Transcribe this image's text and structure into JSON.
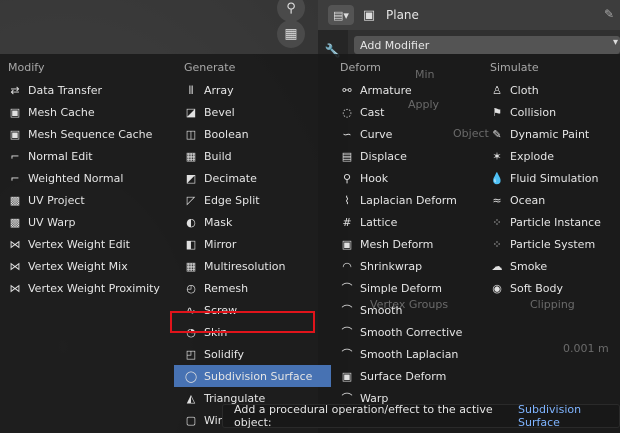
{
  "header": {
    "object_name": "Plane",
    "add_modifier_label": "Add Modifier"
  },
  "ghost": {
    "min": "Min",
    "apply": "Apply",
    "object": "Object",
    "vertex_groups": "Vertex Groups",
    "clipping": "Clipping",
    "value": "0.001 m"
  },
  "menu": {
    "columns": [
      {
        "header": "Modify",
        "items": [
          {
            "label": "Data Transfer",
            "icon": "data-transfer-icon"
          },
          {
            "label": "Mesh Cache",
            "icon": "mesh-cache-icon"
          },
          {
            "label": "Mesh Sequence Cache",
            "icon": "mesh-sequence-cache-icon"
          },
          {
            "label": "Normal Edit",
            "icon": "normal-edit-icon"
          },
          {
            "label": "Weighted Normal",
            "icon": "weighted-normal-icon"
          },
          {
            "label": "UV Project",
            "icon": "uv-project-icon"
          },
          {
            "label": "UV Warp",
            "icon": "uv-warp-icon"
          },
          {
            "label": "Vertex Weight Edit",
            "icon": "vertex-weight-edit-icon"
          },
          {
            "label": "Vertex Weight Mix",
            "icon": "vertex-weight-mix-icon"
          },
          {
            "label": "Vertex Weight Proximity",
            "icon": "vertex-weight-proximity-icon"
          }
        ]
      },
      {
        "header": "Generate",
        "items": [
          {
            "label": "Array",
            "icon": "array-icon"
          },
          {
            "label": "Bevel",
            "icon": "bevel-icon"
          },
          {
            "label": "Boolean",
            "icon": "boolean-icon"
          },
          {
            "label": "Build",
            "icon": "build-icon"
          },
          {
            "label": "Decimate",
            "icon": "decimate-icon"
          },
          {
            "label": "Edge Split",
            "icon": "edge-split-icon"
          },
          {
            "label": "Mask",
            "icon": "mask-icon"
          },
          {
            "label": "Mirror",
            "icon": "mirror-icon"
          },
          {
            "label": "Multiresolution",
            "icon": "multiresolution-icon"
          },
          {
            "label": "Remesh",
            "icon": "remesh-icon"
          },
          {
            "label": "Screw",
            "icon": "screw-icon"
          },
          {
            "label": "Skin",
            "icon": "skin-icon"
          },
          {
            "label": "Solidify",
            "icon": "solidify-icon"
          },
          {
            "label": "Subdivision Surface",
            "icon": "subdivision-surface-icon"
          },
          {
            "label": "Triangulate",
            "icon": "triangulate-icon"
          },
          {
            "label": "Wireframe",
            "icon": "wireframe-icon"
          }
        ]
      },
      {
        "header": "Deform",
        "items": [
          {
            "label": "Armature",
            "icon": "armature-icon"
          },
          {
            "label": "Cast",
            "icon": "cast-icon"
          },
          {
            "label": "Curve",
            "icon": "curve-icon"
          },
          {
            "label": "Displace",
            "icon": "displace-icon"
          },
          {
            "label": "Hook",
            "icon": "hook-icon"
          },
          {
            "label": "Laplacian Deform",
            "icon": "laplacian-deform-icon"
          },
          {
            "label": "Lattice",
            "icon": "lattice-icon"
          },
          {
            "label": "Mesh Deform",
            "icon": "mesh-deform-icon"
          },
          {
            "label": "Shrinkwrap",
            "icon": "shrinkwrap-icon"
          },
          {
            "label": "Simple Deform",
            "icon": "simple-deform-icon"
          },
          {
            "label": "Smooth",
            "icon": "smooth-icon"
          },
          {
            "label": "Smooth Corrective",
            "icon": "smooth-corrective-icon"
          },
          {
            "label": "Smooth Laplacian",
            "icon": "smooth-laplacian-icon"
          },
          {
            "label": "Surface Deform",
            "icon": "surface-deform-icon"
          },
          {
            "label": "Warp",
            "icon": "warp-icon"
          }
        ]
      },
      {
        "header": "Simulate",
        "items": [
          {
            "label": "Cloth",
            "icon": "cloth-icon"
          },
          {
            "label": "Collision",
            "icon": "collision-icon"
          },
          {
            "label": "Dynamic Paint",
            "icon": "dynamic-paint-icon"
          },
          {
            "label": "Explode",
            "icon": "explode-icon"
          },
          {
            "label": "Fluid Simulation",
            "icon": "fluid-simulation-icon"
          },
          {
            "label": "Ocean",
            "icon": "ocean-icon"
          },
          {
            "label": "Particle Instance",
            "icon": "particle-instance-icon"
          },
          {
            "label": "Particle System",
            "icon": "particle-system-icon"
          },
          {
            "label": "Smoke",
            "icon": "smoke-icon"
          },
          {
            "label": "Soft Body",
            "icon": "soft-body-icon"
          }
        ]
      }
    ],
    "active_item": "Subdivision Surface"
  },
  "tooltip": {
    "text": "Add a procedural operation/effect to the active object:",
    "target": "Subdivision Surface"
  },
  "colors": {
    "highlight": "#4772b3",
    "annotation_box": "#e0141b",
    "tooltip_link": "#7fb4ff"
  }
}
